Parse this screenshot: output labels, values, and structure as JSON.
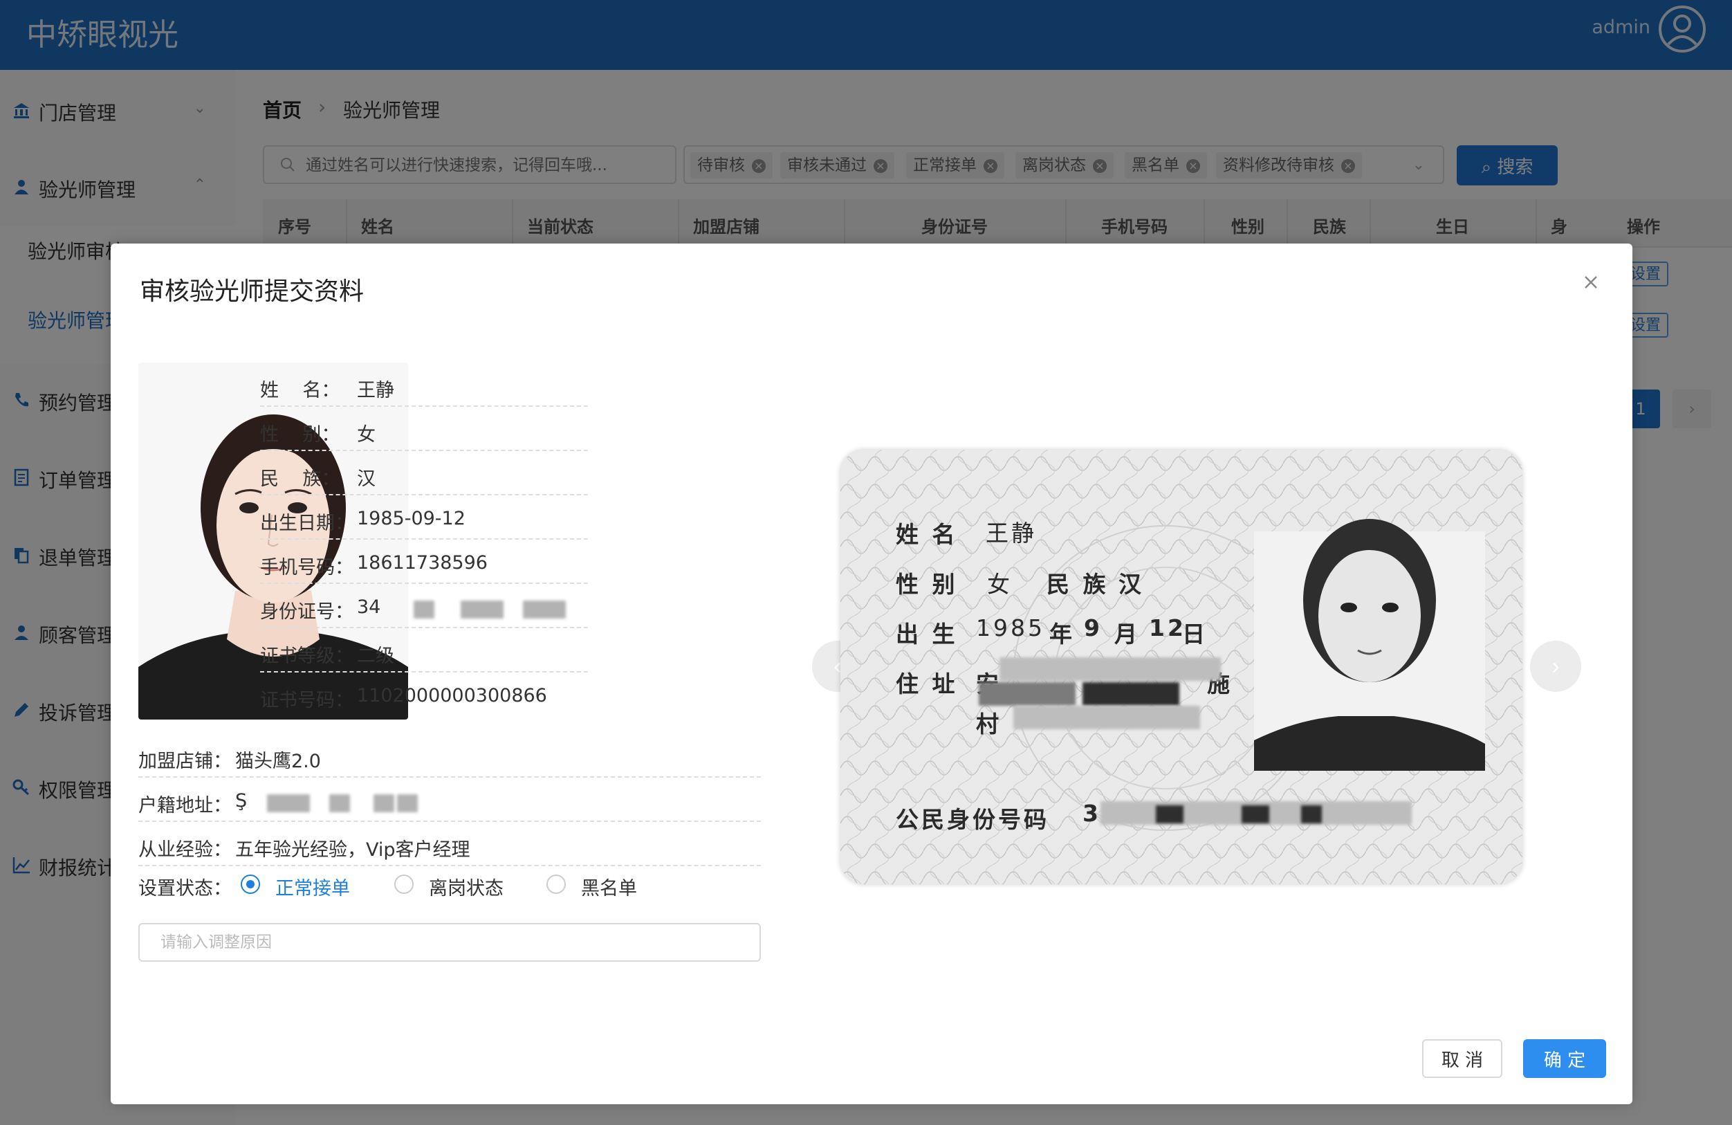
{
  "header": {
    "logo": "中矫眼视光",
    "user": "admin"
  },
  "sidebar": {
    "items": [
      {
        "label": "门店管理",
        "icon": "bank-icon"
      },
      {
        "label": "验光师管理",
        "icon": "user-icon"
      },
      {
        "label": "预约管理",
        "icon": "phone-icon"
      },
      {
        "label": "订单管理",
        "icon": "document-icon"
      },
      {
        "label": "退单管理",
        "icon": "copy-icon"
      },
      {
        "label": "顾客管理",
        "icon": "person-icon"
      },
      {
        "label": "投诉管理",
        "icon": "pencil-icon"
      },
      {
        "label": "权限管理",
        "icon": "key-icon"
      },
      {
        "label": "财报统计",
        "icon": "chart-line-icon"
      }
    ],
    "subitems": [
      {
        "label": "验光师审核"
      },
      {
        "label": "验光师管理"
      }
    ]
  },
  "breadcrumb": {
    "home": "首页",
    "current": "验光师管理"
  },
  "search": {
    "placeholder": "通过姓名可以进行快速搜索，记得回车哦...",
    "button": "搜索"
  },
  "filter_tags": [
    "待审核",
    "审核未通过",
    "正常接单",
    "离岗状态",
    "黑名单",
    "资料修改待审核"
  ],
  "table": {
    "columns": [
      "序号",
      "姓名",
      "当前状态",
      "加盟店铺",
      "身份证号",
      "手机号码",
      "性别",
      "民族",
      "生日",
      "身",
      "操作"
    ],
    "row_action": "设置"
  },
  "pagination": {
    "current": "1",
    "next": "›"
  },
  "modal": {
    "title": "审核验光师提交资料",
    "fields": [
      {
        "label": "姓    名：",
        "value": "王静"
      },
      {
        "label": "性    别：",
        "value": "女"
      },
      {
        "label": "民    族：",
        "value": "汉"
      },
      {
        "label": "出生日期：",
        "value": "1985-09-12"
      },
      {
        "label": "手机号码：",
        "value": "18611738596"
      },
      {
        "label": "身份证号：",
        "value": "34"
      },
      {
        "label": "证书等级：",
        "value": "二级"
      },
      {
        "label": "证书号码：",
        "value": "1102000000300866"
      }
    ],
    "store": {
      "label": "加盟店铺：",
      "value": "猫头鹰2.0"
    },
    "address": {
      "label": "户籍地址：",
      "value": "Ş"
    },
    "experience": {
      "label": "从业经验：",
      "value": "五年验光经验，Vip客户经理"
    },
    "status": {
      "label": "设置状态：",
      "options": [
        "正常接单",
        "离岗状态",
        "黑名单"
      ],
      "selected": "正常接单"
    },
    "reason_placeholder": "请输入调整原因",
    "cancel": "取 消",
    "confirm": "确 定",
    "id_card": {
      "name_label": "姓 名",
      "name": "王静",
      "sex_label": "性 别",
      "sex": "女",
      "nation_label": "民 族",
      "nation": "汉",
      "birth_label": "出 生",
      "birth_year": "1985",
      "year_unit": "年",
      "birth_month": "9",
      "month_unit": "月",
      "birth_day": "12",
      "day_unit": "日",
      "address_label": "住 址",
      "address_fragments": [
        "安",
        "施",
        "村"
      ],
      "id_label": "公民身份号码",
      "id_fragment": "3"
    }
  },
  "colors": {
    "header_blue": "#1f6fc0",
    "accent_blue": "#1e7fdc",
    "button_blue": "#2e8ef0"
  }
}
